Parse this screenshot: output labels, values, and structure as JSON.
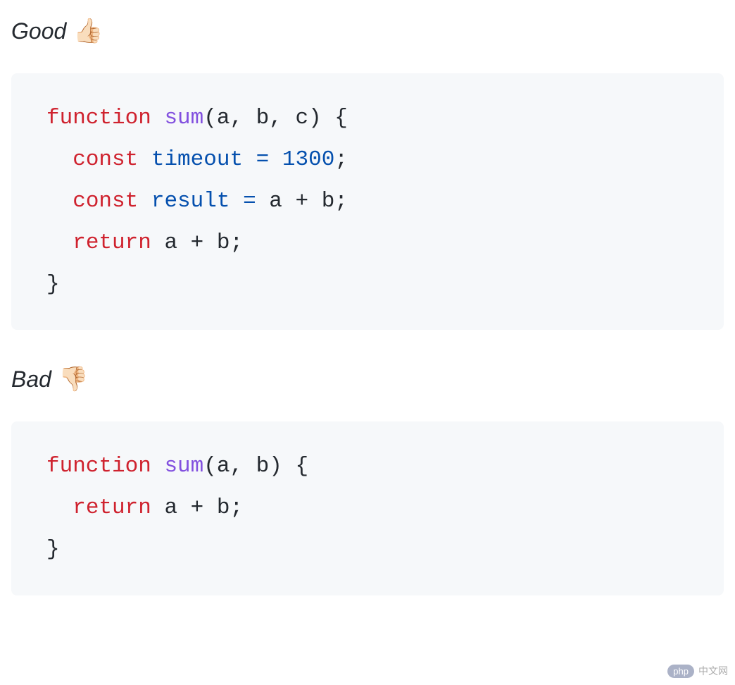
{
  "sections": {
    "good": {
      "label": "Good",
      "emoji": "👍🏻",
      "code": {
        "line1": {
          "function_kw": "function",
          "fn_name": "sum",
          "params": "(a, b, c) {"
        },
        "line2": {
          "const_kw": "const",
          "var_name": "timeout",
          "equals": " = ",
          "value": "1300",
          "semi": ";"
        },
        "line3": {
          "const_kw": "const",
          "var_name": "result",
          "equals": " = ",
          "expr": "a + b",
          "semi": ";"
        },
        "line4": {
          "return_kw": "return",
          "expr": " a + b",
          "semi": ";"
        },
        "line5": {
          "close": "}"
        }
      }
    },
    "bad": {
      "label": "Bad",
      "emoji": "👎🏻",
      "code": {
        "line1": {
          "function_kw": "function",
          "fn_name": "sum",
          "params": "(a, b) {"
        },
        "line2": {
          "return_kw": "return",
          "expr": " a + b",
          "semi": ";"
        },
        "line3": {
          "close": "}"
        }
      }
    }
  },
  "watermark": {
    "badge": "php",
    "text": "中文网"
  }
}
